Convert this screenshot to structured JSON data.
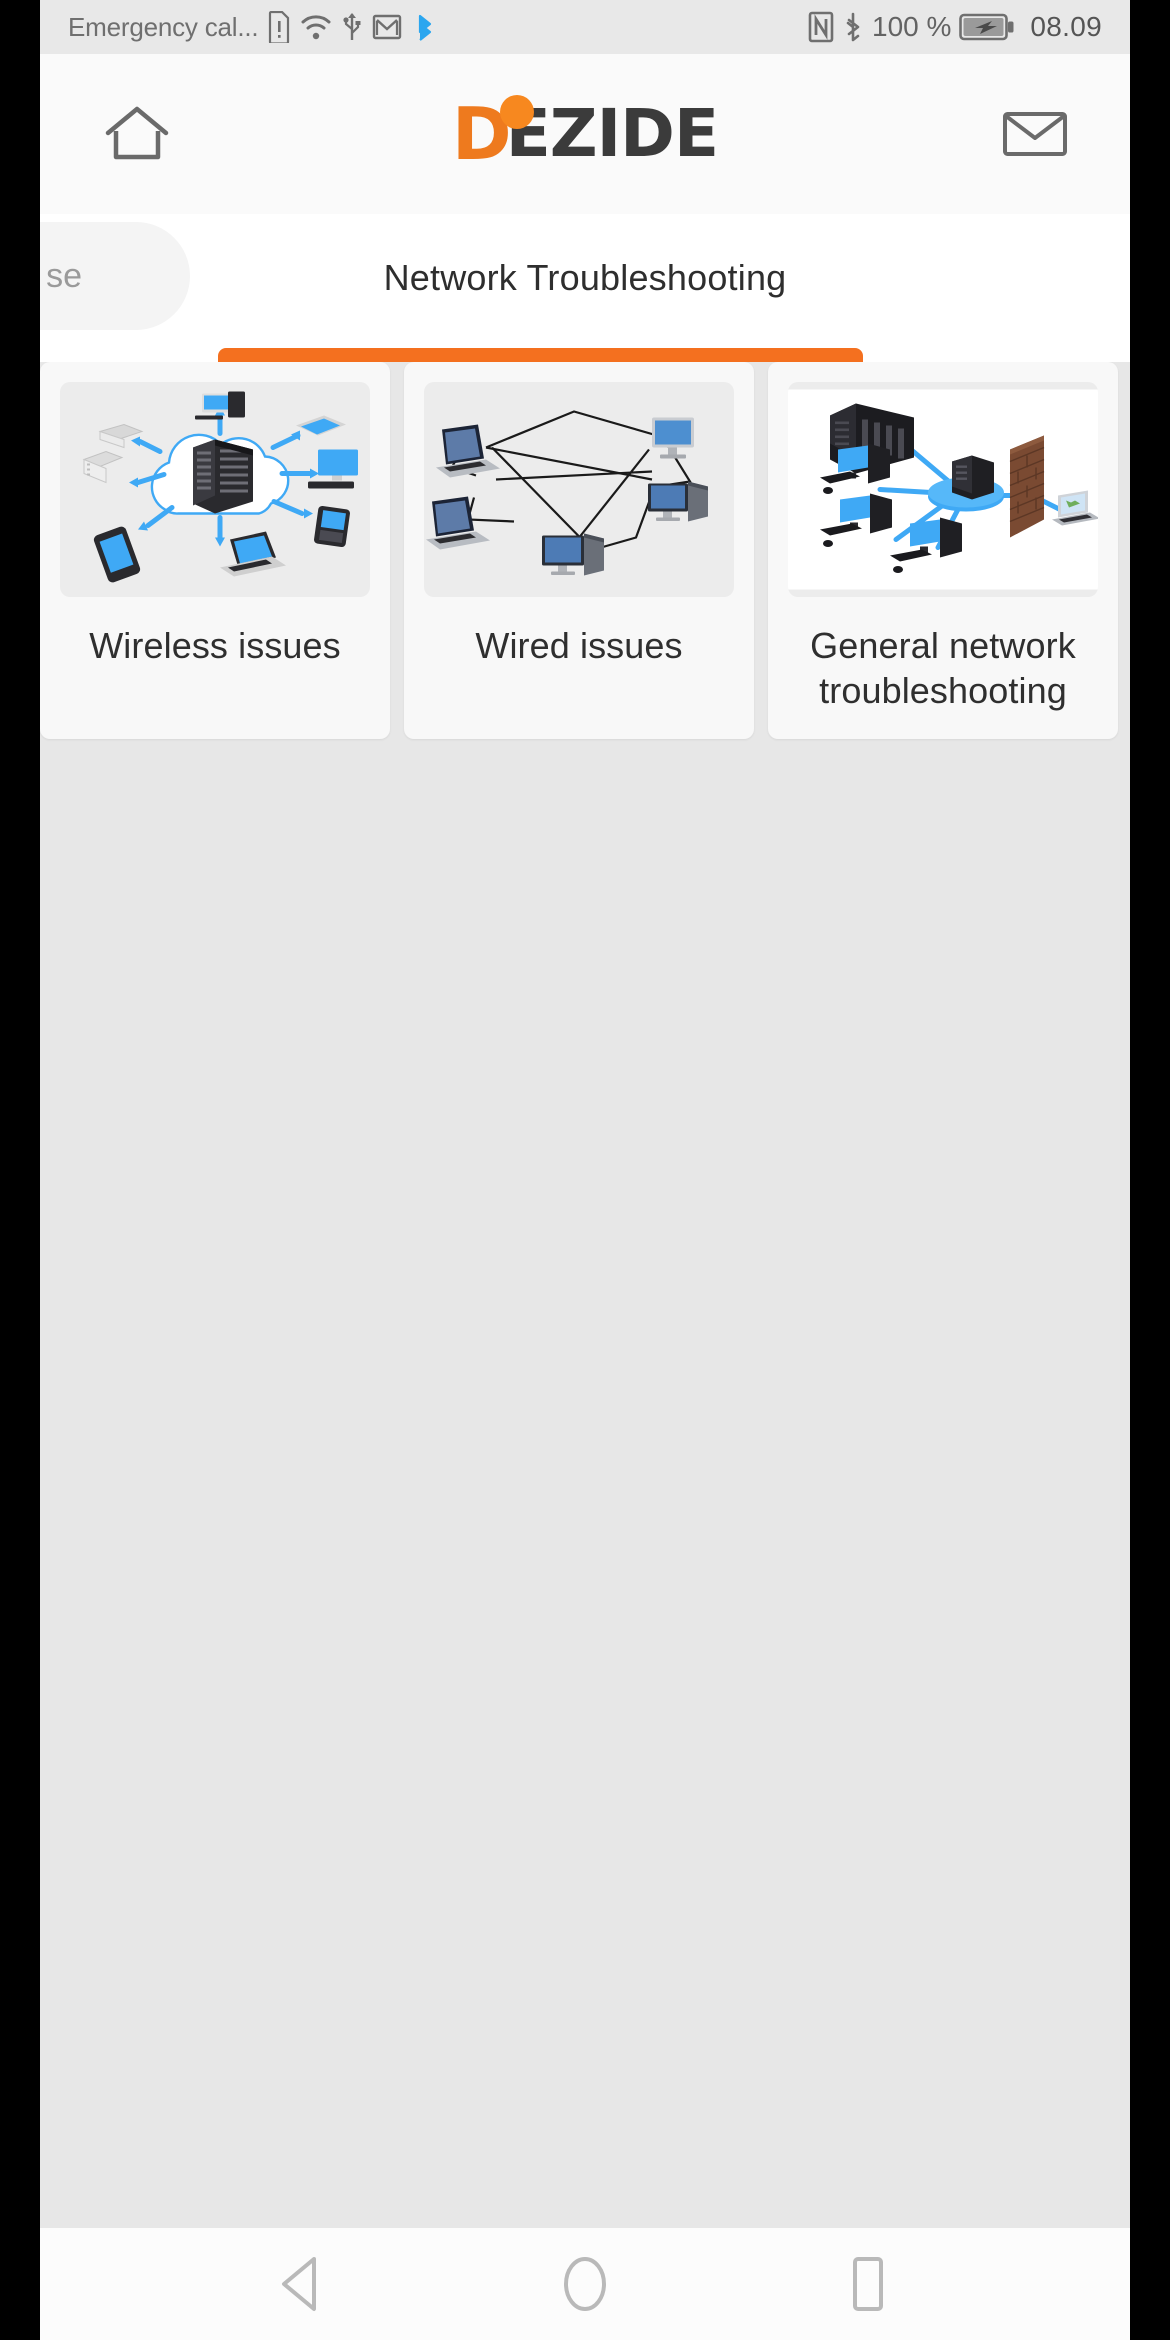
{
  "status_bar": {
    "carrier_text": "Emergency cal...",
    "icons": [
      "sim-warning-icon",
      "wifi-icon",
      "usb-icon",
      "gmail-icon",
      "bluetooth-share-icon"
    ],
    "right_icons": [
      "nfc-icon",
      "bluetooth-icon",
      "battery-charging-icon"
    ],
    "battery_percent": "100 %",
    "time": "08.09"
  },
  "app_header": {
    "home_icon": "home-icon",
    "mail_icon": "envelope-icon",
    "logo": {
      "first_letter": "D",
      "rest": "EZIDE",
      "accent_color": "#ee7a1e",
      "text_color": "#3b3b3b"
    }
  },
  "tabs": {
    "previous_tab_label": "se",
    "active_tab_label": "Network Troubleshooting",
    "indicator_color": "#f4701f"
  },
  "cards": [
    {
      "label": "Wireless issues",
      "image_name": "cloud-network-diagram"
    },
    {
      "label": "Wired issues",
      "image_name": "mesh-network-diagram"
    },
    {
      "label": "General network troubleshooting",
      "image_name": "star-network-firewall-diagram"
    }
  ],
  "nav_bar": {
    "back_label": "back-button",
    "home_label": "home-button",
    "recents_label": "recents-button"
  },
  "colors": {
    "page_background": "#e7e7e7",
    "card_background": "#f8f8f8",
    "accent_orange": "#f4701f",
    "status_bar_background": "#e8e8e8"
  }
}
